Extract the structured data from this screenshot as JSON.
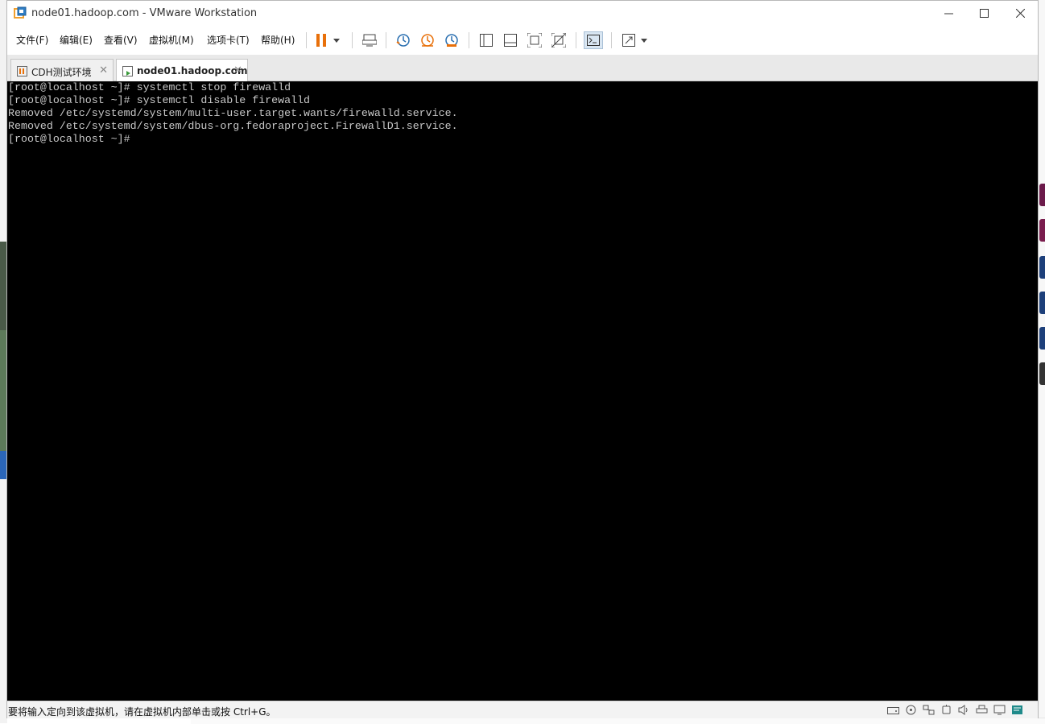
{
  "window": {
    "title": "node01.hadoop.com - VMware Workstation",
    "controls": {
      "minimize": "—",
      "maximize": "☐",
      "close": "✕"
    }
  },
  "menubar": {
    "items": [
      {
        "label": "文件(F)"
      },
      {
        "label": "编辑(E)"
      },
      {
        "label": "查看(V)"
      },
      {
        "label": "虚拟机(M)"
      },
      {
        "label": "选项卡(T)"
      },
      {
        "label": "帮助(H)"
      }
    ]
  },
  "toolbar": {
    "icons": [
      "pause-icon",
      "dropdown-icon",
      "send-ctrl-alt-del-icon",
      "snapshot-take-icon",
      "snapshot-revert-icon",
      "snapshot-manager-icon",
      "library-view-icon",
      "thumbnail-view-icon",
      "full-screen-icon",
      "unity-icon",
      "console-view-icon",
      "stretch-view-icon"
    ],
    "accent_color": "#e8700a"
  },
  "tabs": [
    {
      "label": "CDH测试环境",
      "active": false,
      "close": "✕"
    },
    {
      "label": "node01.hadoop.com",
      "active": true,
      "close": "✕"
    }
  ],
  "console": {
    "lines": [
      "[root@localhost ~]# systemctl stop firewalld",
      "[root@localhost ~]# systemctl disable firewalld",
      "Removed /etc/systemd/system/multi-user.target.wants/firewalld.service.",
      "Removed /etc/systemd/system/dbus-org.fedoraproject.FirewallD1.service.",
      "[root@localhost ~]# "
    ],
    "background": "#000000",
    "foreground": "#c8c8c8"
  },
  "statusbar": {
    "message": "要将输入定向到该虚拟机，请在虚拟机内部单击或按 Ctrl+G。",
    "icons": [
      "hard-disk-icon",
      "cd-dvd-icon",
      "network-icon",
      "usb-icon",
      "sound-icon",
      "printer-icon",
      "display-icon",
      "message-icon"
    ]
  }
}
